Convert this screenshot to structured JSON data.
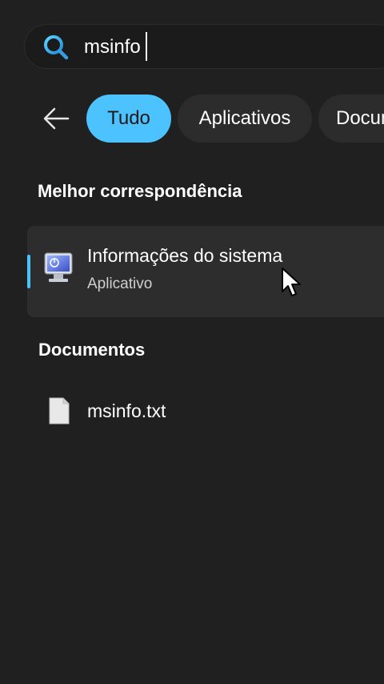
{
  "search": {
    "query": "msinfo",
    "icon": "search-icon"
  },
  "filters": {
    "back_icon": "back-arrow-icon",
    "chips": [
      {
        "label": "Tudo",
        "active": true
      },
      {
        "label": "Aplicativos",
        "active": false
      },
      {
        "label": "Documentos",
        "active": false
      }
    ]
  },
  "best_match": {
    "heading": "Melhor correspondência",
    "item": {
      "title": "Informações do sistema",
      "subtitle": "Aplicativo",
      "icon": "system-information-icon"
    }
  },
  "documents": {
    "heading": "Documentos",
    "items": [
      {
        "label": "msinfo.txt",
        "icon": "text-file-icon"
      }
    ]
  },
  "colors": {
    "background": "#202020",
    "accent": "#4cc2ff",
    "selected_item_bg": "#2d2d2d",
    "chip_bg": "#2c2c2c"
  }
}
